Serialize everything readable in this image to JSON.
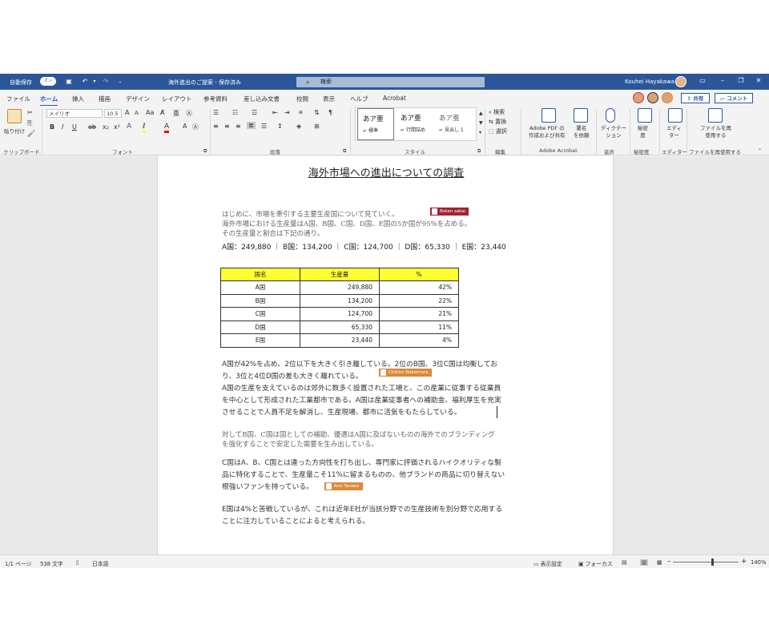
{
  "titlebar": {
    "autosave_label": "自動保存",
    "autosave_state": "オン",
    "doc_title": "海外進出のご提案 - 保存済み",
    "search_placeholder": "検索",
    "user_name": "Kouhei Hayakawa"
  },
  "tabs": [
    "ファイル",
    "ホーム",
    "挿入",
    "描画",
    "デザイン",
    "レイアウト",
    "参考資料",
    "差し込み文書",
    "校閲",
    "表示",
    "ヘルプ",
    "Acrobat"
  ],
  "active_tab": "ホーム",
  "share_label": "共有",
  "comment_label": "コメント",
  "ribbon": {
    "clipboard": {
      "paste": "貼り付け",
      "label": "クリップボード"
    },
    "font": {
      "name": "メイリオ",
      "size": "10.5",
      "label": "フォント"
    },
    "paragraph": {
      "label": "段落"
    },
    "styles": {
      "items": [
        {
          "sample": "あア亜",
          "name": "標準"
        },
        {
          "sample": "あア亜",
          "name": "行間詰め"
        },
        {
          "sample": "あア亜",
          "name": "見出し 1"
        }
      ],
      "label": "スタイル"
    },
    "editing": {
      "find": "検索",
      "replace": "置換",
      "select": "選択",
      "label": "編集"
    },
    "acrobat": {
      "create": "Adobe PDF の\n作成および共有",
      "sign": "署名\nを依頼",
      "label": "Adobe Acrobat"
    },
    "voice": {
      "dictate": "ディクテー\nション",
      "label": "音声"
    },
    "sensitivity": {
      "btn": "秘密\n度",
      "label": "秘密度"
    },
    "editor": {
      "btn": "エディ\nター",
      "label": "エディター"
    },
    "reuse": {
      "btn": "ファイルを再\n使用する",
      "label": "ファイルを再使用する"
    }
  },
  "document": {
    "title": "海外市場への進出についての調査",
    "intro_lines": [
      "はじめに、市場を牽引する主要生産国について見ていく。",
      "海外市場における生産量はA国、B国、C国、D国、E国の5か国が95%を占める。",
      "その生産量と割合は下記の通り。"
    ],
    "totals_line": "A国：249,880 ｜ B国：134,200 ｜ C国：124,700 ｜ D国：65,330 ｜ E国：23,440",
    "table": {
      "headers": [
        "国名",
        "生産量",
        "%"
      ],
      "rows": [
        [
          "A国",
          "249,880",
          "42%"
        ],
        [
          "B国",
          "134,200",
          "22%"
        ],
        [
          "C国",
          "124,700",
          "21%"
        ],
        [
          "D国",
          "65,330",
          "11%"
        ],
        [
          "E国",
          "23,440",
          "4%"
        ]
      ]
    },
    "para_a_lines": [
      "A国が42%を占め、2位以下を大きく引き離している。2位のB国、3位C国は均衡してお",
      "り、3位と4位D国の差も大きく離れている。"
    ],
    "para_a2_lines": [
      "A国の生産を支えているのは郊外に数多く設置された工場と、この産業に従事する従業員",
      "を中心として形成された工業都市である。A国は産業従事者への補助金、福利厚生を充実",
      "させることで人員不足を解消し、生産現場、都市に活気をもたらしている。"
    ],
    "para_b_lines": [
      "対してB国、C国は国としての補助、優遇はA国に及ばないものの海外でのブランディング",
      "を強化することで安定した需要を生み出している。"
    ],
    "para_c_lines": [
      "C国はA、B、C国とは違った方向性を打ち出し、専門家に評価されるハイクオリティな製",
      "品に特化することで、生産量こそ11%に留まるものの、他ブランドの商品に切り替えない",
      "根強いファンを持っている。"
    ],
    "para_e_lines": [
      "E国は4%と苦戦しているが、これは近年E社が当該分野での生産技術を別分野で応用する",
      "ことに注力していることによると考えられる。"
    ],
    "comments": [
      "Botan sakai",
      "Chihiro Nakamura",
      "Ami Tanaka"
    ]
  },
  "statusbar": {
    "page": "1/1 ページ",
    "words": "538 文字",
    "language": "日本語",
    "display_settings": "表示設定",
    "focus": "フォーカス",
    "zoom": "140%"
  },
  "colors": {
    "brand": "#2b579a",
    "table_header": "#ffff33",
    "comment_red": "#a0242e",
    "comment_orange": "#d98a3a"
  }
}
